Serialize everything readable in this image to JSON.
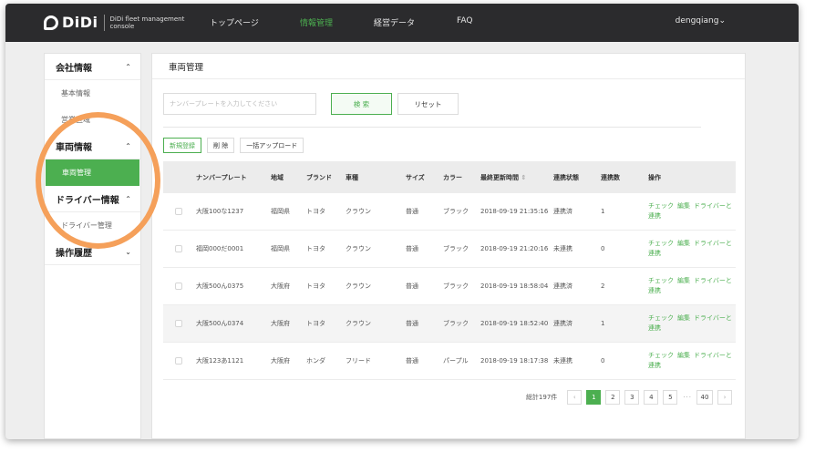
{
  "app": {
    "logo_text": "DiDi",
    "logo_sub": "DiDi fleet management console"
  },
  "nav": {
    "items": [
      "トップページ",
      "情報管理",
      "経営データ",
      "FAQ"
    ],
    "active_index": 1,
    "user": "dengqiang"
  },
  "sidebar": {
    "groups": [
      {
        "label": "会社情報",
        "chevron": "up"
      },
      {
        "label": "車両情報",
        "chevron": "up"
      },
      {
        "label": "ドライバー情報",
        "chevron": "up"
      },
      {
        "label": "操作履歴",
        "chevron": "down"
      }
    ],
    "items": [
      {
        "label": "基本情報"
      },
      {
        "label": "営業区域"
      },
      {
        "label": "車両管理",
        "active": true
      },
      {
        "label": "ドライバー管理"
      }
    ]
  },
  "main": {
    "title": "車両管理",
    "search_placeholder": "ナンバープレートを入力してください",
    "search_button": "検 索",
    "reset_button": "リセット",
    "actions": [
      "新規登録",
      "削 除",
      "一括アップロード"
    ]
  },
  "table": {
    "columns": [
      "ナンバープレート",
      "地域",
      "ブランド",
      "車種",
      "サイズ",
      "カラー",
      "最終更新時間",
      "連携状態",
      "連携数",
      "操作"
    ],
    "rows": [
      [
        "大阪100な1237",
        "福岡県",
        "トヨタ",
        "クラウン",
        "普通",
        "ブラック",
        "2018-09-19 21:35:16",
        "連携済",
        "1"
      ],
      [
        "福岡000だ0001",
        "福岡県",
        "トヨタ",
        "クラウン",
        "普通",
        "ブラック",
        "2018-09-19 21:20:16",
        "未連携",
        "0"
      ],
      [
        "大阪500ん0375",
        "大阪府",
        "トヨタ",
        "クラウン",
        "普通",
        "ブラック",
        "2018-09-19 18:58:04",
        "連携済",
        "2"
      ],
      [
        "大阪500ん0374",
        "大阪府",
        "トヨタ",
        "クラウン",
        "普通",
        "ブラック",
        "2018-09-19 18:52:40",
        "連携済",
        "1"
      ],
      [
        "大阪123あ1121",
        "大阪府",
        "ホンダ",
        "フリード",
        "普通",
        "パープル",
        "2018-09-19 18:17:38",
        "未連携",
        "0"
      ]
    ],
    "row_actions": [
      "チェック",
      "編集",
      "ドライバーと連携"
    ]
  },
  "pagination": {
    "total": "総計197件",
    "prev": "‹",
    "pages": [
      "1",
      "2",
      "3",
      "4",
      "5"
    ],
    "dots": "···",
    "last": "40",
    "next": "›",
    "current": "1"
  },
  "colors": {
    "accent": "#4caf50",
    "nav_bg": "#2b2b2d",
    "highlight": "#f5a05a"
  }
}
